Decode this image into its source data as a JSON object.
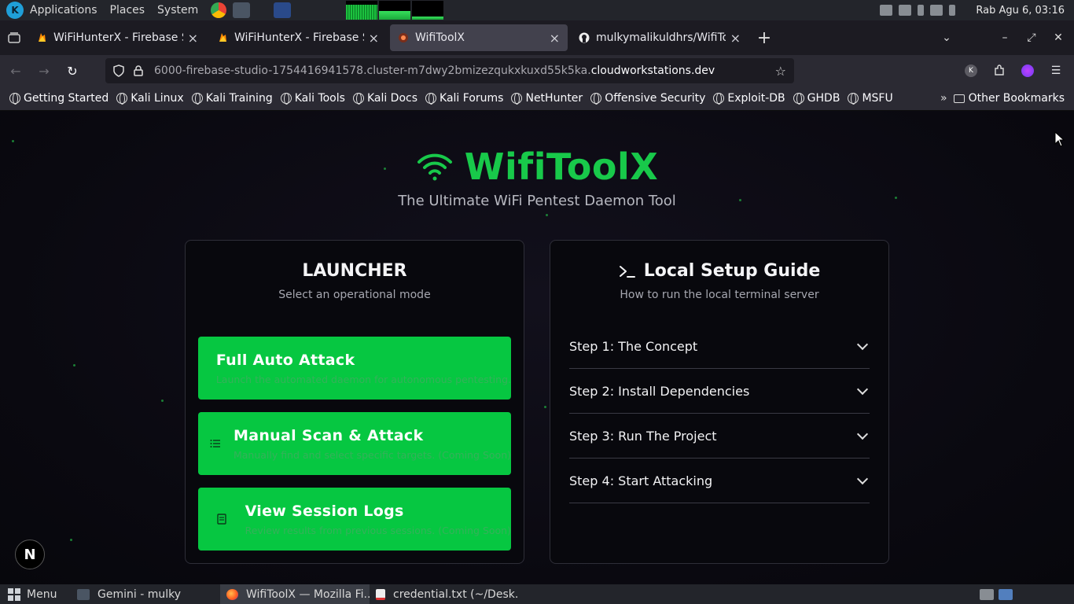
{
  "top_panel": {
    "menus": [
      "Applications",
      "Places",
      "System"
    ],
    "clock": "Rab Agu  6, 03:16"
  },
  "tabs": [
    {
      "title": "WiFiHunterX - Firebase St",
      "active": false
    },
    {
      "title": "WiFiHunterX - Firebase St",
      "active": false
    },
    {
      "title": "WifiToolX",
      "active": true
    },
    {
      "title": "mulkymalikuldhrs/WifiToo",
      "active": false
    }
  ],
  "urlbar": {
    "url_prefix": "6000-firebase-studio-1754416941578.cluster-m7dwy2bmizezqukxkuxd55k5ka.",
    "url_host": "cloudworkstations.dev"
  },
  "bookmarks": [
    "Getting Started",
    "Kali Linux",
    "Kali Training",
    "Kali Tools",
    "Kali Docs",
    "Kali Forums",
    "NetHunter",
    "Offensive Security",
    "Exploit-DB",
    "GHDB",
    "MSFU"
  ],
  "other_bookmarks": "Other Bookmarks",
  "hero": {
    "title": "WifiToolX",
    "tagline": "The Ultimate WiFi Pentest Daemon Tool"
  },
  "launcher": {
    "title": "LAUNCHER",
    "subtitle": "Select an operational mode",
    "modes": [
      {
        "title": "Full Auto Attack",
        "desc": "Launch the automated daemon for autonomous pentesting."
      },
      {
        "title": "Manual Scan & Attack",
        "desc": "Manually find and select specific targets. (Coming Soon)"
      },
      {
        "title": "View Session Logs",
        "desc": "Review results from previous sessions. (Coming Soon)"
      }
    ]
  },
  "guide": {
    "title": "Local Setup Guide",
    "subtitle": "How to run the local terminal server",
    "steps": [
      "Step 1: The Concept",
      "Step 2: Install Dependencies",
      "Step 3: Run The Project",
      "Step 4: Start Attacking"
    ]
  },
  "badge": "N",
  "taskbar": {
    "menu": "Menu",
    "items": [
      "Gemini - mulky",
      "WifiToolX — Mozilla Fi...",
      "credential.txt (~/Desk..."
    ]
  },
  "colors": {
    "accent": "#06c741",
    "brand": "#18c94a",
    "page_bg": "#0a0910"
  }
}
